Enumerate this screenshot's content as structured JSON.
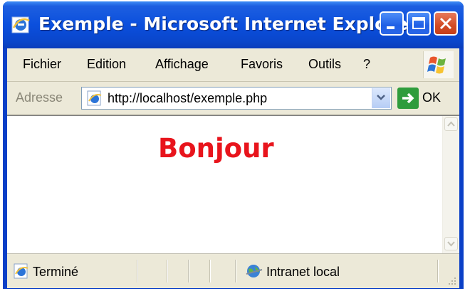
{
  "window": {
    "title": "Exemple - Microsoft Internet Exploreur"
  },
  "menu": {
    "items": [
      "Fichier",
      "Edition",
      "Affichage",
      "Favoris",
      "Outils",
      "?"
    ]
  },
  "address": {
    "label": "Adresse",
    "url": "http://localhost/exemple.php",
    "go_label": "OK"
  },
  "content": {
    "heading": "Bonjour"
  },
  "status": {
    "text": "Terminé",
    "zone": "Intranet local"
  },
  "colors": {
    "titlebar": "#0b4fdd",
    "heading": "#e8141c",
    "chrome": "#ece9d8"
  },
  "icons": [
    "ie-icon",
    "minimize-icon",
    "maximize-icon",
    "close-icon",
    "windows-logo-icon",
    "dropdown-arrow-icon",
    "go-arrow-icon",
    "page-icon",
    "globe-icon",
    "resize-grip-icon"
  ]
}
